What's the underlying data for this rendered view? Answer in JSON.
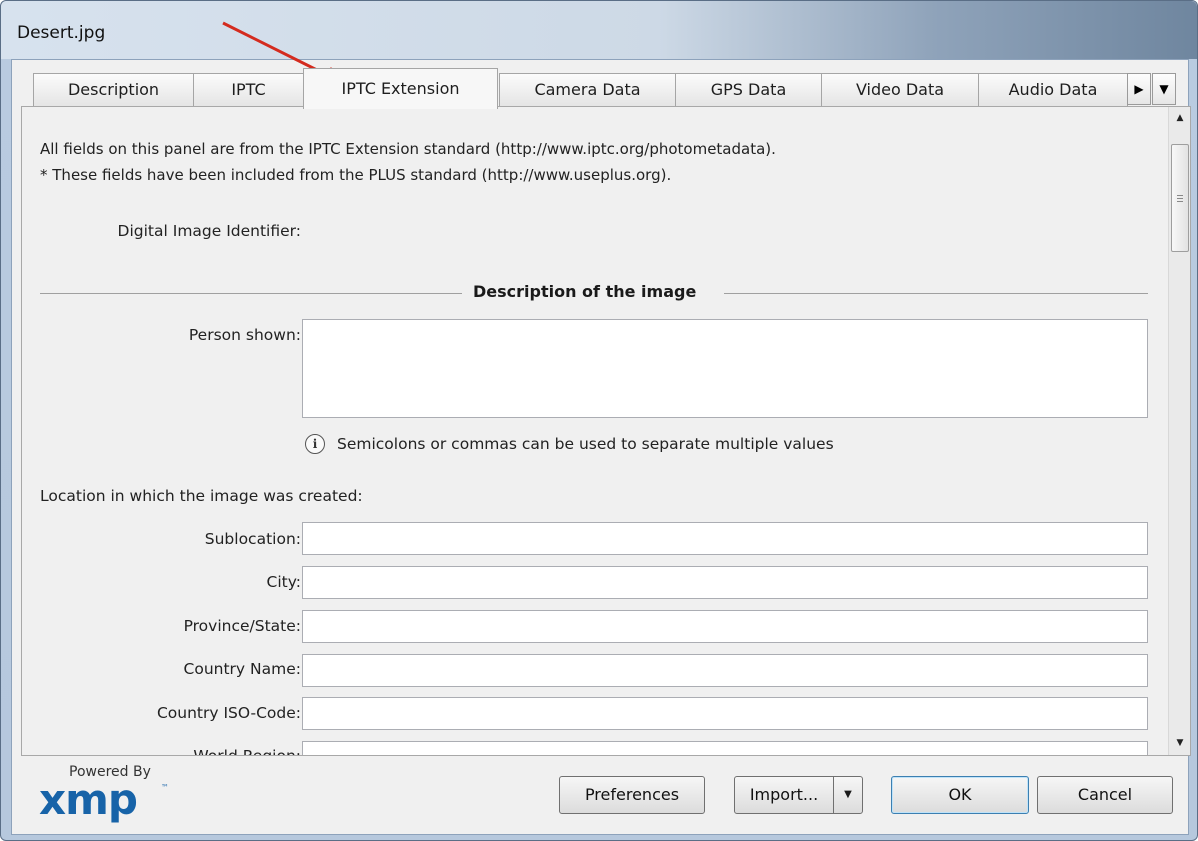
{
  "window": {
    "title": "Desert.jpg"
  },
  "tabs": [
    {
      "label": "Description",
      "active": false
    },
    {
      "label": "IPTC",
      "active": false
    },
    {
      "label": "IPTC Extension",
      "active": true
    },
    {
      "label": "Camera Data",
      "active": false
    },
    {
      "label": "GPS Data",
      "active": false
    },
    {
      "label": "Video Data",
      "active": false
    },
    {
      "label": "Audio Data",
      "active": false
    }
  ],
  "tab_scroll": {
    "right_icon": "triangle-right-icon",
    "menu_icon": "triangle-down-icon"
  },
  "panel": {
    "intro_line1": "All fields on this panel are from the IPTC Extension standard (http://www.iptc.org/photometadata).",
    "intro_line2": "* These fields have been included from the PLUS standard (http://www.useplus.org).",
    "digital_image_identifier_label": "Digital Image Identifier:",
    "section_title": "Description of the image",
    "person_shown_label": "Person shown:",
    "person_shown_value": "",
    "hint": "Semicolons or commas can be used to separate multiple values",
    "location_heading": "Location in which the image was created:",
    "location_fields": [
      {
        "label": "Sublocation:",
        "value": ""
      },
      {
        "label": "City:",
        "value": ""
      },
      {
        "label": "Province/State:",
        "value": ""
      },
      {
        "label": "Country Name:",
        "value": ""
      },
      {
        "label": "Country ISO-Code:",
        "value": ""
      },
      {
        "label": "World Region:",
        "value": ""
      }
    ]
  },
  "footer": {
    "powered_by": "Powered By",
    "logo_text": "xmp",
    "logo_tm": "™",
    "preferences_label": "Preferences",
    "import_label": "Import...",
    "ok_label": "OK",
    "cancel_label": "Cancel"
  },
  "colors": {
    "annotation_arrow": "#d42b1e",
    "logo_blue": "#1763a8"
  }
}
